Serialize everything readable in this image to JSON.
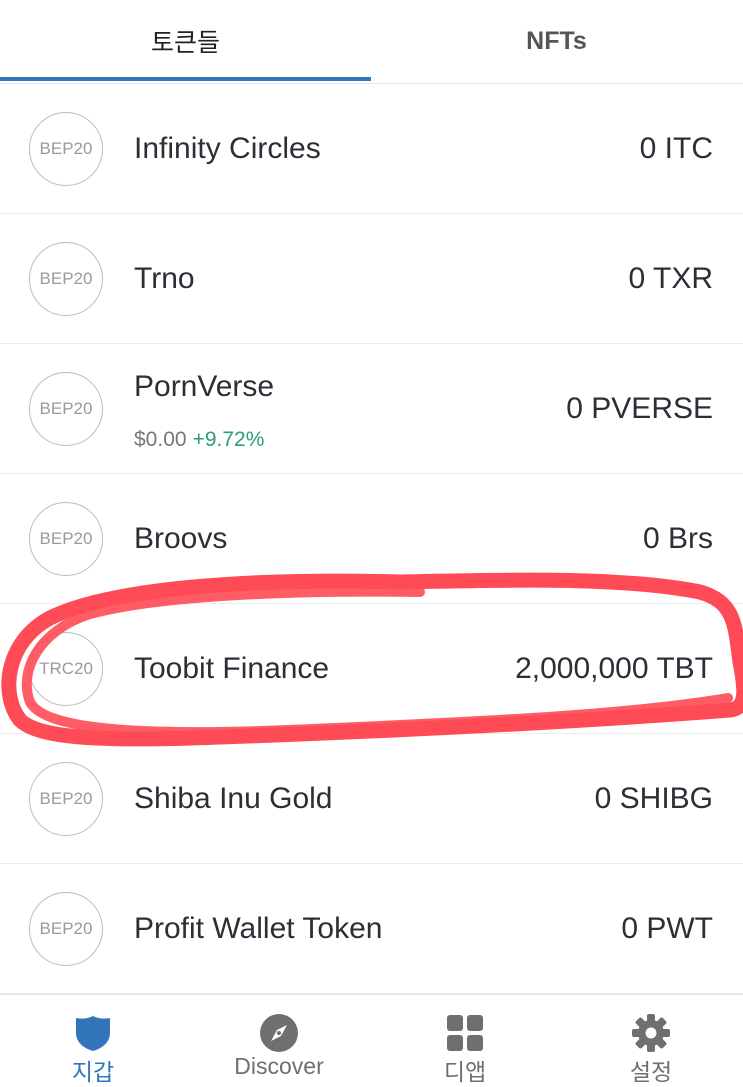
{
  "tabs": [
    {
      "label": "토큰들",
      "active": true
    },
    {
      "label": "NFTs",
      "active": false
    }
  ],
  "tokens": [
    {
      "badge": "BEP20",
      "name": "Infinity Circles",
      "balance": "0 ITC"
    },
    {
      "badge": "BEP20",
      "name": "Trno",
      "balance": "0 TXR"
    },
    {
      "badge": "BEP20",
      "name": "PornVerse",
      "price": "$0.00",
      "change": "+9.72%",
      "balance": "0 PVERSE"
    },
    {
      "badge": "BEP20",
      "name": "Broovs",
      "balance": "0 Brs"
    },
    {
      "badge": "TRC20",
      "name": "Toobit Finance",
      "balance": "2,000,000 TBT"
    },
    {
      "badge": "BEP20",
      "name": "Shiba Inu Gold",
      "balance": "0 SHIBG"
    },
    {
      "badge": "BEP20",
      "name": "Profit Wallet Token",
      "balance": "0 PWT"
    }
  ],
  "bottom_nav": [
    {
      "label": "지갑",
      "icon": "shield-icon",
      "active": true
    },
    {
      "label": "Discover",
      "icon": "compass-icon",
      "active": false
    },
    {
      "label": "디앱",
      "icon": "grid-icon",
      "active": false
    },
    {
      "label": "설정",
      "icon": "gear-icon",
      "active": false
    }
  ],
  "colors": {
    "accent": "#3375bb",
    "positive_change": "#2e9e73",
    "annotation": "#ff4b55"
  }
}
